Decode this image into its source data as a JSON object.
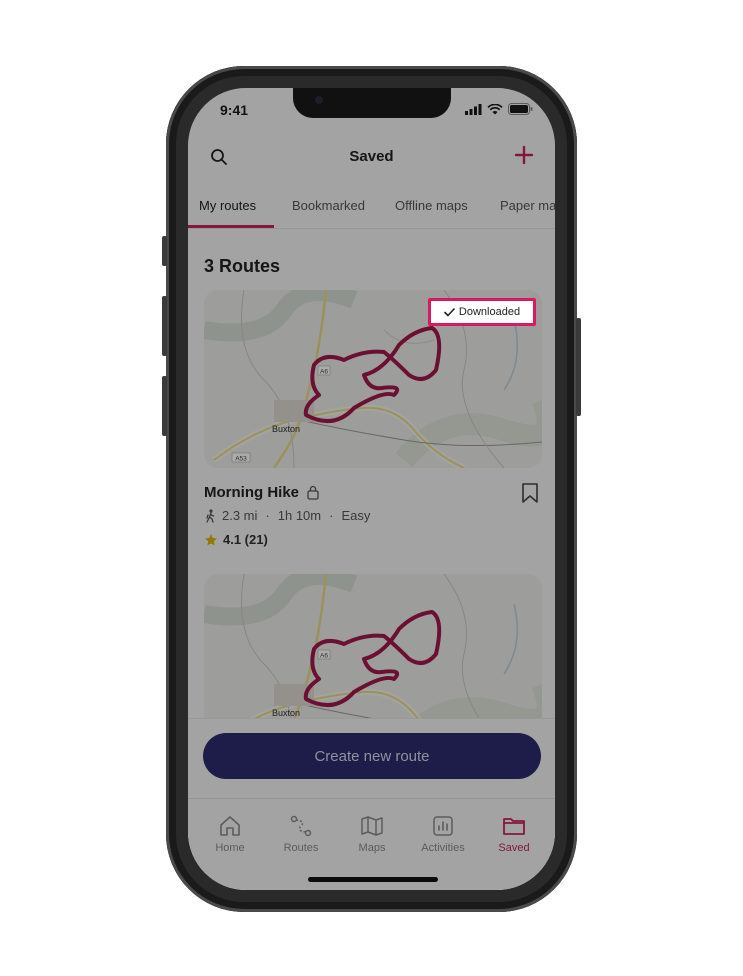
{
  "status_bar": {
    "time": "9:41"
  },
  "header": {
    "title": "Saved"
  },
  "tabs": [
    {
      "label": "My routes",
      "active": true
    },
    {
      "label": "Bookmarked",
      "active": false
    },
    {
      "label": "Offline maps",
      "active": false
    },
    {
      "label": "Paper maps",
      "active": false
    }
  ],
  "routes_heading": "3 Routes",
  "cards": [
    {
      "badge": "Downloaded",
      "map_labels": {
        "road1": "A6",
        "town": "Buxton",
        "road2": "A53"
      },
      "name": "Morning Hike",
      "distance": "2.3 mi",
      "duration": "1h 10m",
      "difficulty": "Easy",
      "rating": "4.1 (21)"
    },
    {
      "map_labels": {
        "road1": "A6",
        "town": "Buxton"
      }
    }
  ],
  "meta_separator": "·",
  "create_button": "Create new route",
  "nav": [
    {
      "label": "Home",
      "icon": "home-icon",
      "active": false
    },
    {
      "label": "Routes",
      "icon": "routes-icon",
      "active": false
    },
    {
      "label": "Maps",
      "icon": "map-icon",
      "active": false
    },
    {
      "label": "Activities",
      "icon": "activities-icon",
      "active": false
    },
    {
      "label": "Saved",
      "icon": "folder-icon",
      "active": true
    }
  ],
  "colors": {
    "accent": "#c7235a",
    "route_line": "#a0174d",
    "button_bg": "#2e2a6e",
    "highlight_border": "#d81b60",
    "star": "#e0b400"
  }
}
